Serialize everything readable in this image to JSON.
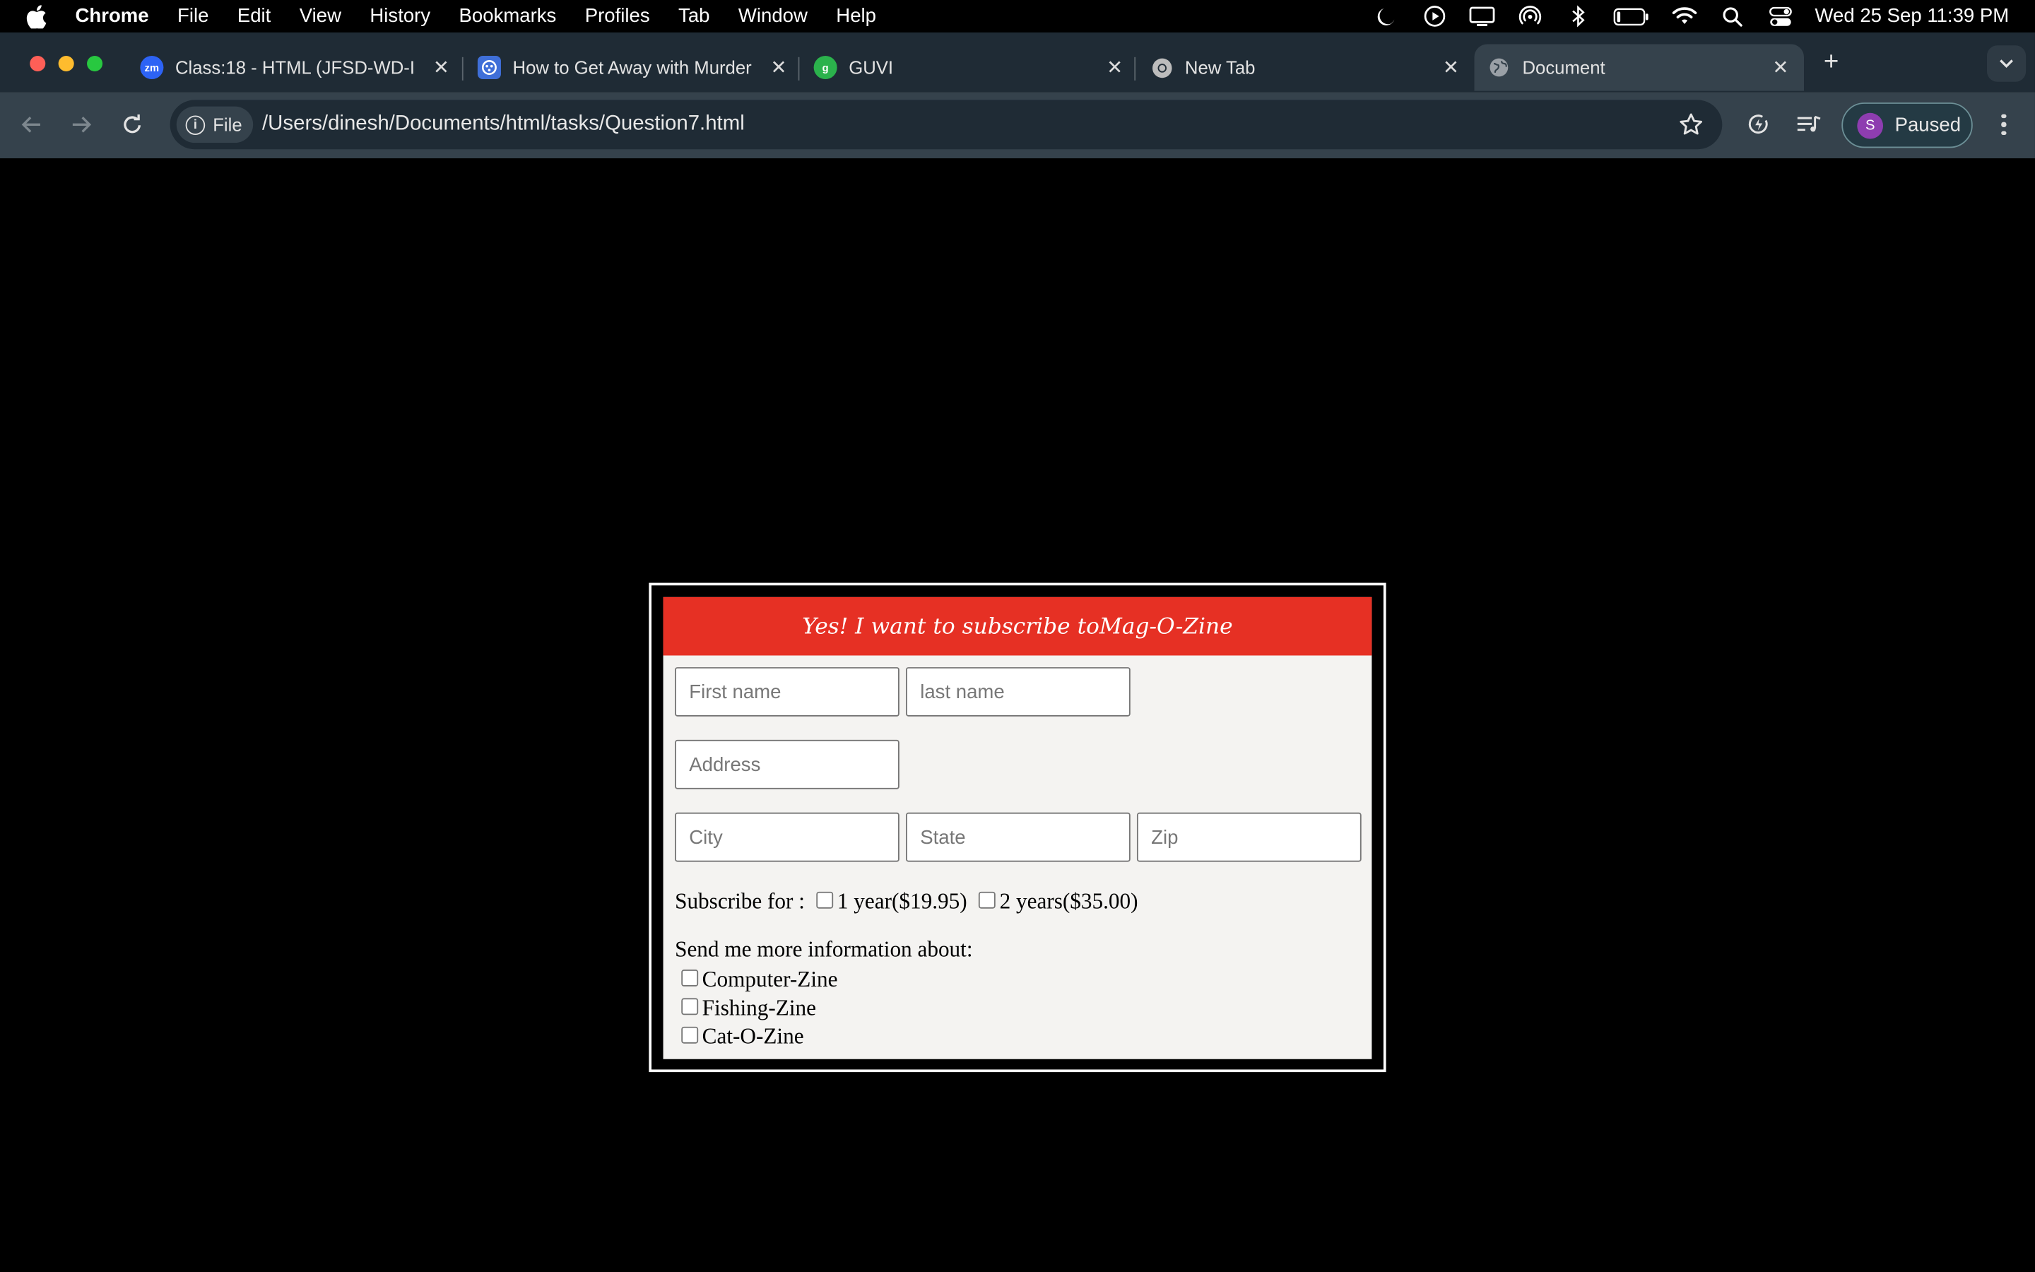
{
  "menubar": {
    "app_name": "Chrome",
    "menus": [
      "File",
      "Edit",
      "View",
      "History",
      "Bookmarks",
      "Profiles",
      "Tab",
      "Window",
      "Help"
    ],
    "clock": "Wed 25 Sep  11:39 PM"
  },
  "tabs": [
    {
      "title": "Class:18 - HTML (JFSD-WD-I",
      "icon": "zoom-icon",
      "icon_text": "zm",
      "icon_color": "#2d63f5"
    },
    {
      "title": "How to Get Away with Murder",
      "icon": "movie-site-icon",
      "icon_color": "#3f6fd8"
    },
    {
      "title": "GUVI",
      "icon": "guvi-icon",
      "icon_color": "#2bb24c"
    },
    {
      "title": "New Tab",
      "icon": "chrome-icon",
      "icon_color": "#bcbcbc"
    },
    {
      "title": "Document",
      "icon": "globe-icon",
      "icon_color": "#9aa0a6",
      "active": true
    }
  ],
  "toolbar": {
    "chip_label": "File",
    "url": "/Users/dinesh/Documents/html/tasks/Question7.html",
    "profile_initial": "S",
    "profile_label": "Paused"
  },
  "form": {
    "heading": "Yes! I want to subscribe toMag-O-Zine",
    "first_name_placeholder": "First name",
    "last_name_placeholder": "last name",
    "address_placeholder": "Address",
    "city_placeholder": "City",
    "state_placeholder": "State",
    "zip_placeholder": "Zip",
    "subscribe_label": "Subscribe for :",
    "option_1_year": "1 year($19.95)",
    "option_2_years": "2 years($35.00)",
    "info_label": "Send me more information about:",
    "info_options": [
      "Computer-Zine",
      "Fishing-Zine",
      "Cat-O-Zine"
    ]
  },
  "colors": {
    "header_red": "#e63024",
    "tabstrip": "#1f2b35",
    "toolbar": "#35424c"
  }
}
